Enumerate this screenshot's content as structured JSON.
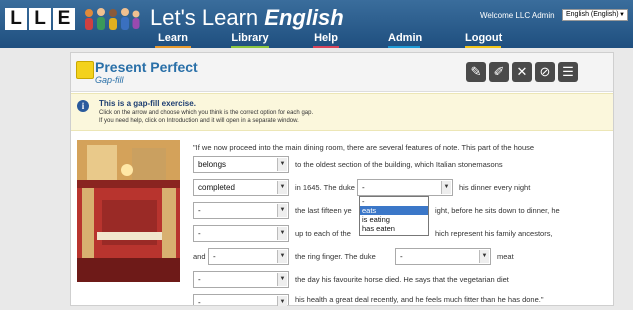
{
  "header": {
    "logo_letters": [
      "L",
      "L",
      "E"
    ],
    "title_prefix": "Let's Learn ",
    "title_emphasis": "English",
    "welcome": "Welcome LLC Admin",
    "language": "English (English)",
    "nav": [
      {
        "label": "Learn",
        "color": "#e89a2d"
      },
      {
        "label": "Library",
        "color": "#8cc63f"
      },
      {
        "label": "Help",
        "color": "#d6435a"
      },
      {
        "label": "Admin",
        "color": "#1f9ad6"
      },
      {
        "label": "Logout",
        "color": "#f3c618"
      }
    ]
  },
  "lesson": {
    "title": "Present Perfect",
    "subtitle": "Gap-fill",
    "toolbar": [
      "notes-icon",
      "pencil-icon",
      "close-icon",
      "cancel-icon",
      "list-icon"
    ]
  },
  "info": {
    "heading": "This is a gap-fill exercise.",
    "line1": "Click on the arrow and choose which you think is the correct option for each gap.",
    "line2": "If you need help, click on Introduction and it will open in a separate window."
  },
  "exercise": {
    "intro": "\"If we now proceed into the main dining room, there are several features of note. This part of the house",
    "gaps": [
      "belongs",
      "completed",
      "-",
      "-",
      "-",
      "-",
      "-",
      "-",
      "-"
    ],
    "fragments": {
      "f1": "to the oldest section of the building, which Italian stonemasons",
      "f2a": "in 1645. The duke",
      "f2b": "his dinner every night",
      "f3a": "the last fifteen ye",
      "f3b": "ight, before he sits down to dinner, he",
      "f4a": "up to each of the",
      "f4b": "hich represent his family ancestors,",
      "f5a": "and",
      "f5b": "the ring finger. The duke",
      "f5c": "meat",
      "f6": "the day his favourite horse died. He says that the vegetarian diet",
      "f7": "his health a great deal recently, and he feels much fitter than he has done.\""
    },
    "dropdown_options": [
      "-",
      "eats",
      "is eating",
      "has eaten"
    ],
    "dropdown_highlight": "eats"
  }
}
